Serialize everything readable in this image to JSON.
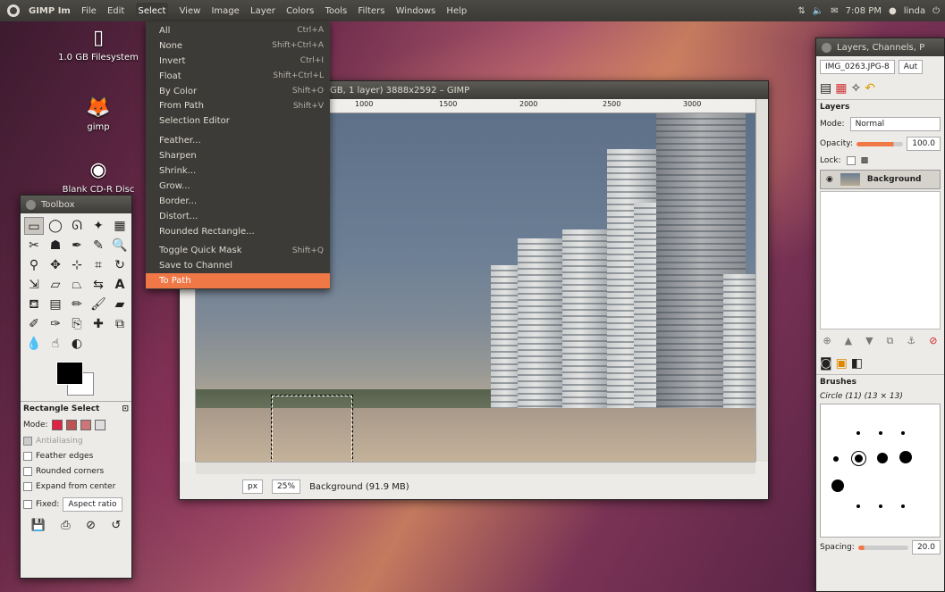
{
  "topbar": {
    "app_name": "GIMP Im",
    "menus": [
      "File",
      "Edit",
      "Select",
      "View",
      "Image",
      "Layer",
      "Colors",
      "Tools",
      "Filters",
      "Windows",
      "Help"
    ],
    "time": "7:08 PM",
    "user": "linda"
  },
  "desktop": {
    "icons": [
      {
        "label": "1.0 GB Filesystem",
        "icon": "usb-drive-icon"
      },
      {
        "label": "gimp",
        "icon": "gimp-wilber-icon"
      },
      {
        "label": "Blank CD-R Disc",
        "icon": "cd-icon"
      }
    ]
  },
  "select_menu": {
    "items": [
      {
        "label": "All",
        "accel": "Ctrl+A"
      },
      {
        "label": "None",
        "accel": "Shift+Ctrl+A"
      },
      {
        "label": "Invert",
        "accel": "Ctrl+I"
      },
      {
        "label": "Float",
        "accel": "Shift+Ctrl+L"
      },
      {
        "label": "By Color",
        "accel": "Shift+O"
      },
      {
        "label": "From Path",
        "accel": "Shift+V"
      },
      {
        "label": "Selection Editor",
        "accel": ""
      },
      {
        "label": "Feather...",
        "accel": ""
      },
      {
        "label": "Sharpen",
        "accel": ""
      },
      {
        "label": "Shrink...",
        "accel": ""
      },
      {
        "label": "Grow...",
        "accel": ""
      },
      {
        "label": "Border...",
        "accel": ""
      },
      {
        "label": "Distort...",
        "accel": ""
      },
      {
        "label": "Rounded Rectangle...",
        "accel": ""
      },
      {
        "label": "Toggle Quick Mask",
        "accel": "Shift+Q"
      },
      {
        "label": "Save to Channel",
        "accel": ""
      },
      {
        "label": "To Path",
        "accel": ""
      }
    ],
    "highlighted": "To Path"
  },
  "toolbox": {
    "title": "Toolbox",
    "tool_options_title": "Rectangle Select",
    "mode_label": "Mode:",
    "antialiasing": "Antialiasing",
    "feather": "Feather edges",
    "rounded": "Rounded corners",
    "expand": "Expand from center",
    "fixed": "Fixed:",
    "fixed_value": "Aspect ratio"
  },
  "image_window": {
    "title": "GB, 1 layer) 3888x2592 – GIMP",
    "ruler_ticks": [
      "1000",
      "1500",
      "2000",
      "2500",
      "3000"
    ],
    "unit": "px",
    "zoom": "25%",
    "status": "Background (91.9 MB)"
  },
  "layers_dock": {
    "title": "Layers, Channels, P",
    "image_select": "IMG_0263.JPG-8",
    "auto_label": "Aut",
    "section_layers": "Layers",
    "mode_label": "Mode:",
    "mode_value": "Normal",
    "opacity_label": "Opacity:",
    "opacity_value": "100.0",
    "lock_label": "Lock:",
    "layer_name": "Background",
    "section_brushes": "Brushes",
    "brush_name": "Circle (11) (13 × 13)",
    "spacing_label": "Spacing:",
    "spacing_value": "20.0"
  },
  "colors": {
    "menu_highlight": "#f07746",
    "panel": "#3c3b37"
  }
}
